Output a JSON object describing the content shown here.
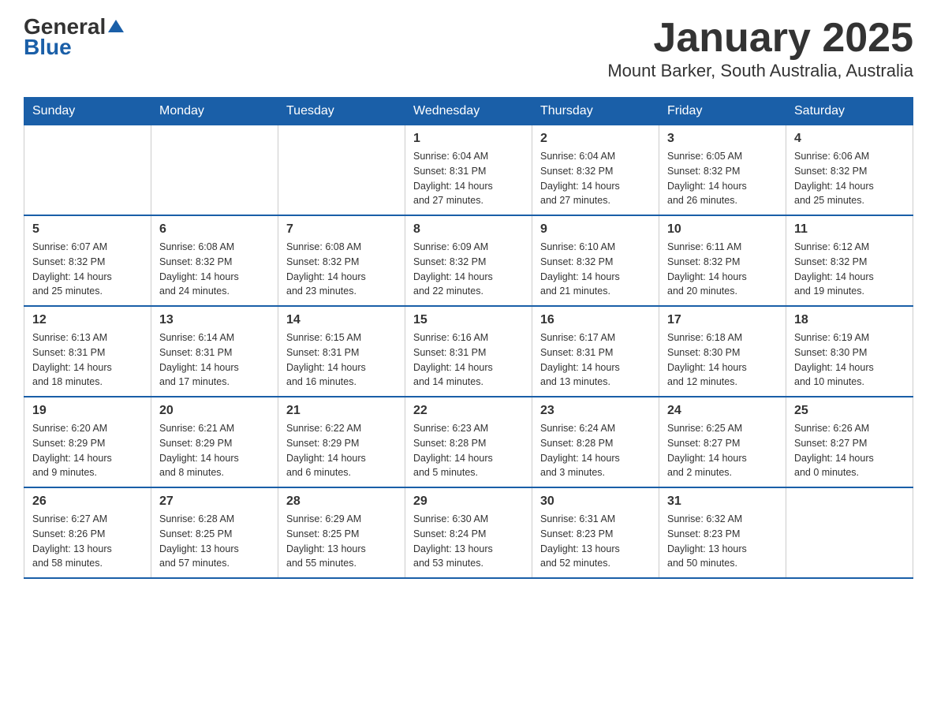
{
  "logo": {
    "part1": "General",
    "part2": "Blue"
  },
  "title": "January 2025",
  "subtitle": "Mount Barker, South Australia, Australia",
  "weekdays": [
    "Sunday",
    "Monday",
    "Tuesday",
    "Wednesday",
    "Thursday",
    "Friday",
    "Saturday"
  ],
  "weeks": [
    [
      {
        "day": "",
        "info": ""
      },
      {
        "day": "",
        "info": ""
      },
      {
        "day": "",
        "info": ""
      },
      {
        "day": "1",
        "info": "Sunrise: 6:04 AM\nSunset: 8:31 PM\nDaylight: 14 hours\nand 27 minutes."
      },
      {
        "day": "2",
        "info": "Sunrise: 6:04 AM\nSunset: 8:32 PM\nDaylight: 14 hours\nand 27 minutes."
      },
      {
        "day": "3",
        "info": "Sunrise: 6:05 AM\nSunset: 8:32 PM\nDaylight: 14 hours\nand 26 minutes."
      },
      {
        "day": "4",
        "info": "Sunrise: 6:06 AM\nSunset: 8:32 PM\nDaylight: 14 hours\nand 25 minutes."
      }
    ],
    [
      {
        "day": "5",
        "info": "Sunrise: 6:07 AM\nSunset: 8:32 PM\nDaylight: 14 hours\nand 25 minutes."
      },
      {
        "day": "6",
        "info": "Sunrise: 6:08 AM\nSunset: 8:32 PM\nDaylight: 14 hours\nand 24 minutes."
      },
      {
        "day": "7",
        "info": "Sunrise: 6:08 AM\nSunset: 8:32 PM\nDaylight: 14 hours\nand 23 minutes."
      },
      {
        "day": "8",
        "info": "Sunrise: 6:09 AM\nSunset: 8:32 PM\nDaylight: 14 hours\nand 22 minutes."
      },
      {
        "day": "9",
        "info": "Sunrise: 6:10 AM\nSunset: 8:32 PM\nDaylight: 14 hours\nand 21 minutes."
      },
      {
        "day": "10",
        "info": "Sunrise: 6:11 AM\nSunset: 8:32 PM\nDaylight: 14 hours\nand 20 minutes."
      },
      {
        "day": "11",
        "info": "Sunrise: 6:12 AM\nSunset: 8:32 PM\nDaylight: 14 hours\nand 19 minutes."
      }
    ],
    [
      {
        "day": "12",
        "info": "Sunrise: 6:13 AM\nSunset: 8:31 PM\nDaylight: 14 hours\nand 18 minutes."
      },
      {
        "day": "13",
        "info": "Sunrise: 6:14 AM\nSunset: 8:31 PM\nDaylight: 14 hours\nand 17 minutes."
      },
      {
        "day": "14",
        "info": "Sunrise: 6:15 AM\nSunset: 8:31 PM\nDaylight: 14 hours\nand 16 minutes."
      },
      {
        "day": "15",
        "info": "Sunrise: 6:16 AM\nSunset: 8:31 PM\nDaylight: 14 hours\nand 14 minutes."
      },
      {
        "day": "16",
        "info": "Sunrise: 6:17 AM\nSunset: 8:31 PM\nDaylight: 14 hours\nand 13 minutes."
      },
      {
        "day": "17",
        "info": "Sunrise: 6:18 AM\nSunset: 8:30 PM\nDaylight: 14 hours\nand 12 minutes."
      },
      {
        "day": "18",
        "info": "Sunrise: 6:19 AM\nSunset: 8:30 PM\nDaylight: 14 hours\nand 10 minutes."
      }
    ],
    [
      {
        "day": "19",
        "info": "Sunrise: 6:20 AM\nSunset: 8:29 PM\nDaylight: 14 hours\nand 9 minutes."
      },
      {
        "day": "20",
        "info": "Sunrise: 6:21 AM\nSunset: 8:29 PM\nDaylight: 14 hours\nand 8 minutes."
      },
      {
        "day": "21",
        "info": "Sunrise: 6:22 AM\nSunset: 8:29 PM\nDaylight: 14 hours\nand 6 minutes."
      },
      {
        "day": "22",
        "info": "Sunrise: 6:23 AM\nSunset: 8:28 PM\nDaylight: 14 hours\nand 5 minutes."
      },
      {
        "day": "23",
        "info": "Sunrise: 6:24 AM\nSunset: 8:28 PM\nDaylight: 14 hours\nand 3 minutes."
      },
      {
        "day": "24",
        "info": "Sunrise: 6:25 AM\nSunset: 8:27 PM\nDaylight: 14 hours\nand 2 minutes."
      },
      {
        "day": "25",
        "info": "Sunrise: 6:26 AM\nSunset: 8:27 PM\nDaylight: 14 hours\nand 0 minutes."
      }
    ],
    [
      {
        "day": "26",
        "info": "Sunrise: 6:27 AM\nSunset: 8:26 PM\nDaylight: 13 hours\nand 58 minutes."
      },
      {
        "day": "27",
        "info": "Sunrise: 6:28 AM\nSunset: 8:25 PM\nDaylight: 13 hours\nand 57 minutes."
      },
      {
        "day": "28",
        "info": "Sunrise: 6:29 AM\nSunset: 8:25 PM\nDaylight: 13 hours\nand 55 minutes."
      },
      {
        "day": "29",
        "info": "Sunrise: 6:30 AM\nSunset: 8:24 PM\nDaylight: 13 hours\nand 53 minutes."
      },
      {
        "day": "30",
        "info": "Sunrise: 6:31 AM\nSunset: 8:23 PM\nDaylight: 13 hours\nand 52 minutes."
      },
      {
        "day": "31",
        "info": "Sunrise: 6:32 AM\nSunset: 8:23 PM\nDaylight: 13 hours\nand 50 minutes."
      },
      {
        "day": "",
        "info": ""
      }
    ]
  ]
}
